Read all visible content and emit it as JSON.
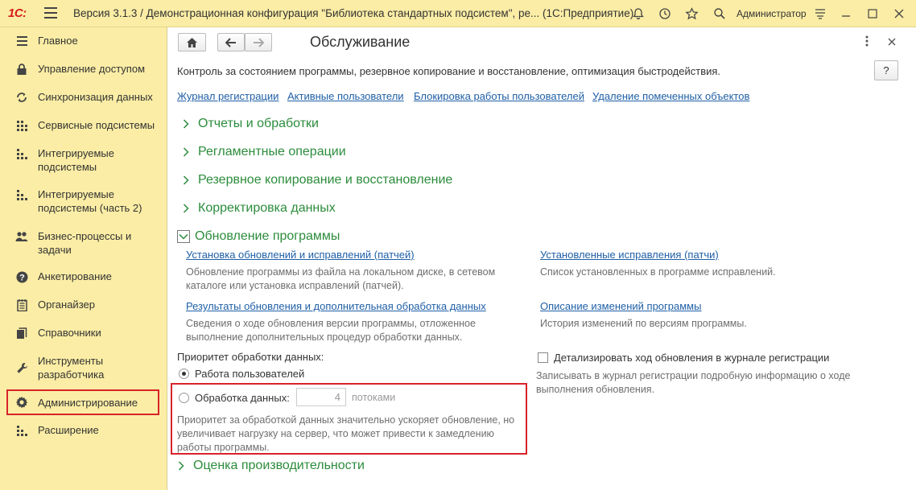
{
  "app": {
    "logo": "1С:",
    "title": "Версия 3.1.3 / Демонстрационная конфигурация \"Библиотека стандартных подсистем\", ре... (1С:Предприятие)",
    "user": "Администратор"
  },
  "sidebar": {
    "items": [
      {
        "label": "Главное",
        "icon": "menu-icon"
      },
      {
        "label": "Управление доступом",
        "icon": "lock-icon"
      },
      {
        "label": "Синхронизация данных",
        "icon": "sync-icon"
      },
      {
        "label": "Сервисные подсистемы",
        "icon": "grid-icon"
      },
      {
        "label": "Интегрируемые подсистемы",
        "icon": "blocks-icon"
      },
      {
        "label": "Интегрируемые подсистемы (часть 2)",
        "icon": "blocks-icon"
      },
      {
        "label": "Бизнес-процессы и задачи",
        "icon": "users-icon"
      },
      {
        "label": "Анкетирование",
        "icon": "question-icon"
      },
      {
        "label": "Органайзер",
        "icon": "notepad-icon"
      },
      {
        "label": "Справочники",
        "icon": "books-icon"
      },
      {
        "label": "Инструменты разработчика",
        "icon": "wrench-icon"
      },
      {
        "label": "Администрирование",
        "icon": "gear-icon"
      },
      {
        "label": "Расширение",
        "icon": "blocks-icon"
      }
    ]
  },
  "main": {
    "title": "Обслуживание",
    "description": "Контроль за состоянием программы, резервное копирование и восстановление, оптимизация быстродействия.",
    "help": "?",
    "top_links": [
      "Журнал регистрации",
      "Активные пользователи",
      "Блокировка работы пользователей",
      "Удаление помеченных объектов"
    ],
    "sections": [
      "Отчеты и обработки",
      "Регламентные операции",
      "Резервное копирование и восстановление",
      "Корректировка данных",
      "Обновление программы",
      "Оценка производительности"
    ],
    "update": {
      "link1": "Установка обновлений и исправлений (патчей)",
      "desc1": "Обновление программы из файла на локальном диске, в сетевом каталоге или установка исправлений (патчей).",
      "link2": "Установленные исправления (патчи)",
      "desc2": "Список установленных в программе исправлений.",
      "link3": "Результаты обновления и дополнительная обработка данных",
      "desc3": "Сведения о ходе обновления версии программы, отложенное выполнение дополнительных процедур обработки данных.",
      "link4": "Описание изменений программы",
      "desc4": "История изменений по версиям программы.",
      "priority_label": "Приоритет обработки данных:",
      "radio1": "Работа пользователей",
      "radio2": "Обработка данных:",
      "threads_value": "4",
      "threads_unit": "потоками",
      "priority_note": "Приоритет за обработкой данных значительно ускоряет обновление, но увеличивает нагрузку на сервер, что может привести к замедлению работы программы.",
      "checkbox_label": "Детализировать ход обновления в журнале регистрации",
      "checkbox_note": "Записывать в журнал регистрации подробную информацию о ходе выполнения обновления."
    }
  },
  "colors": {
    "panel": "#fbeda5",
    "accent_green": "#2c8c3c",
    "link_blue": "#1f5fa6",
    "highlight_red": "#d8232a"
  }
}
